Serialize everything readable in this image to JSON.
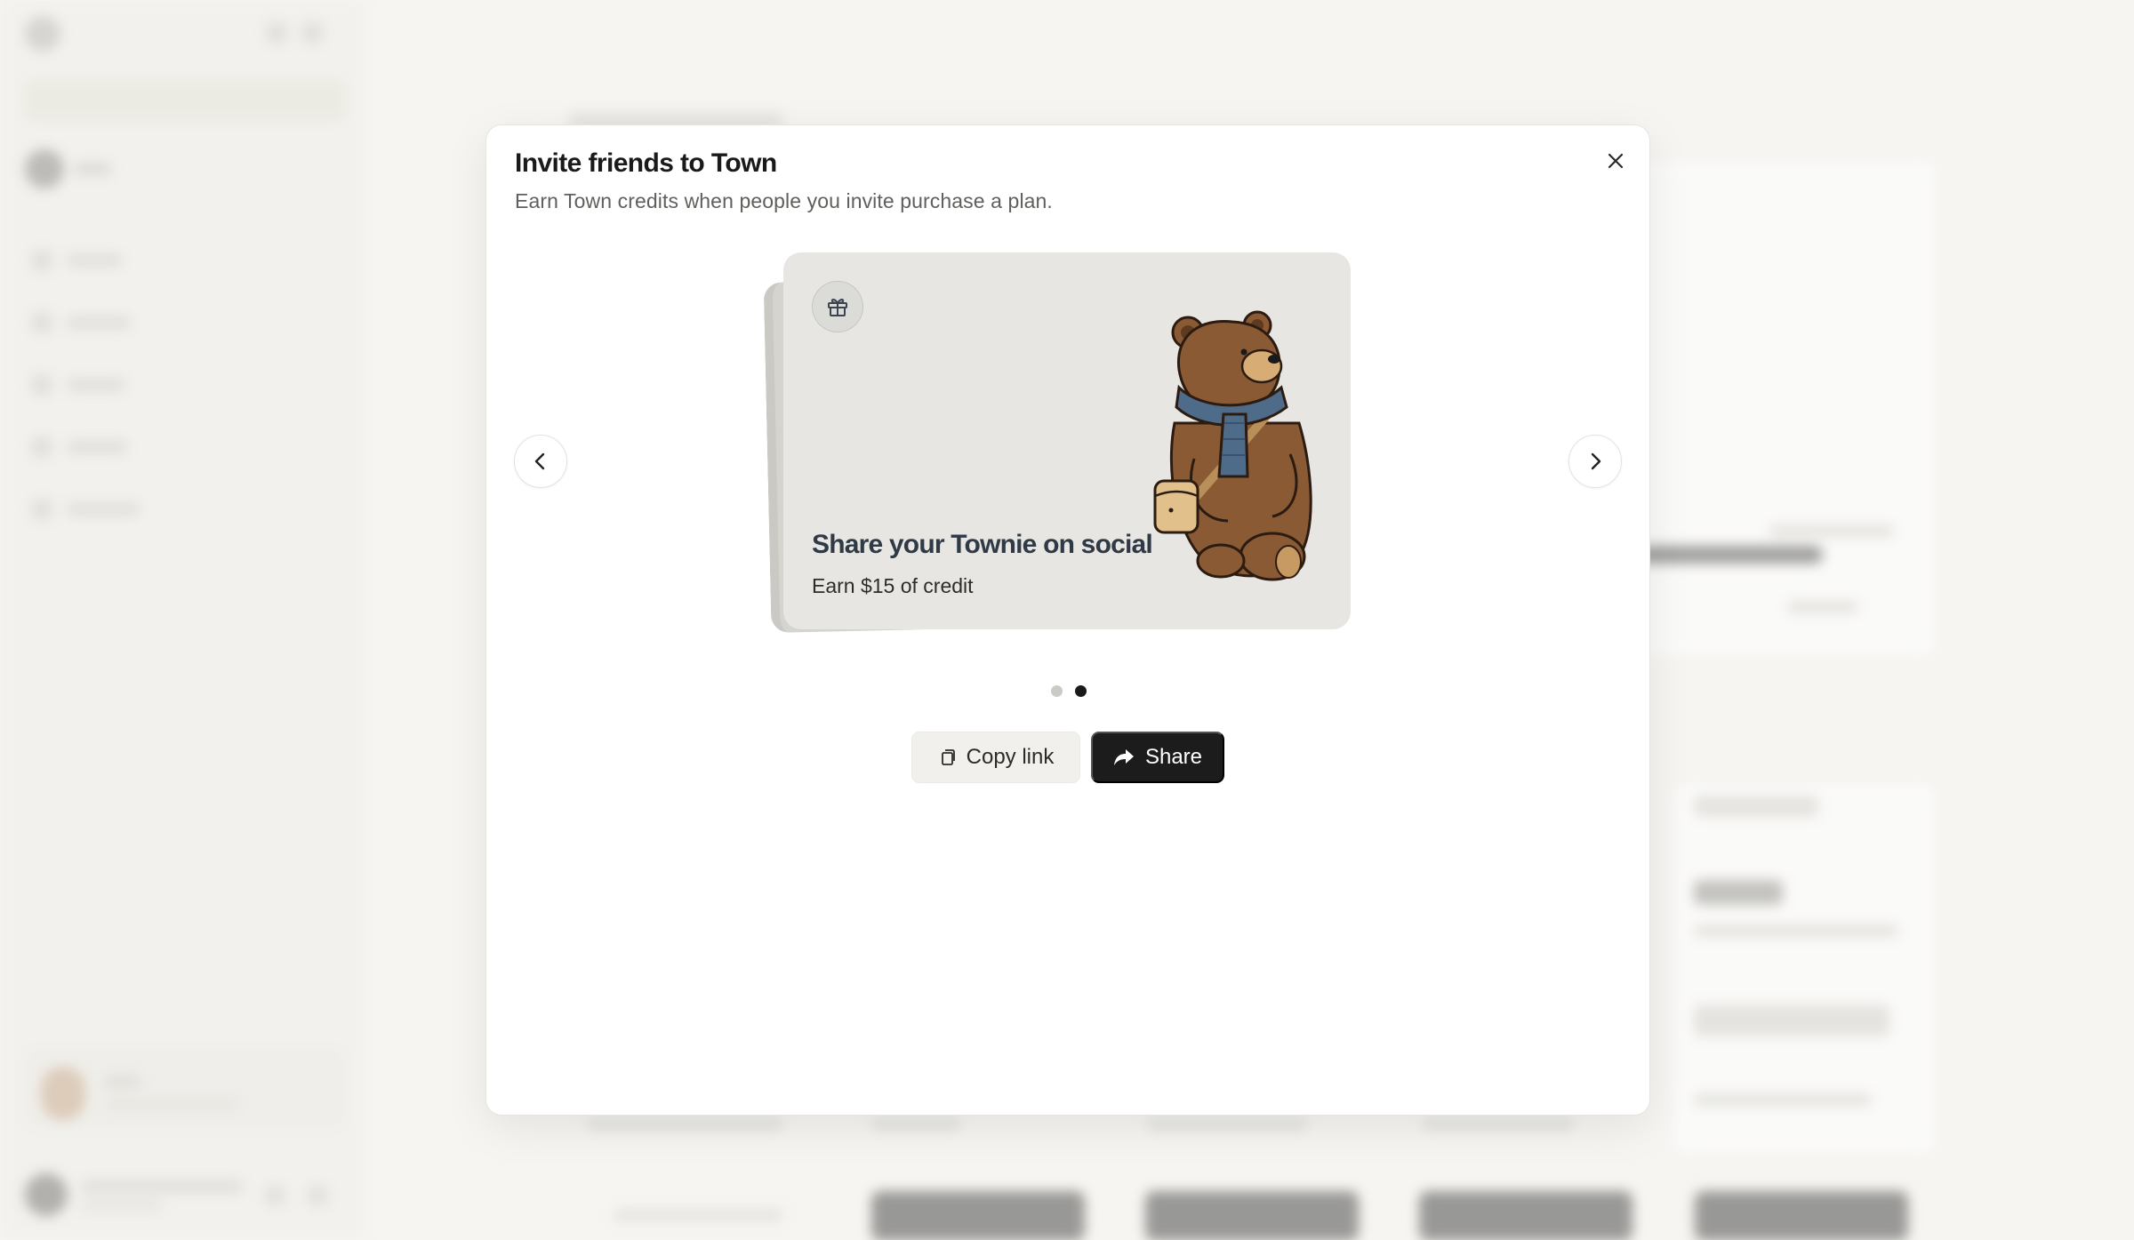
{
  "modal": {
    "title": "Invite friends to Town",
    "subtitle": "Earn Town credits when people you invite purchase a plan."
  },
  "carousel": {
    "active_index": 1,
    "total_slides": 2,
    "slide": {
      "icon": "gift-icon",
      "headline": "Share your Townie on social",
      "subtext": "Earn $15 of credit",
      "illustration": "bear-with-scarf-and-satchel"
    }
  },
  "actions": {
    "copy_label": "Copy link",
    "copy_icon": "copy-icon",
    "share_label": "Share",
    "share_icon": "share-arrow-icon"
  },
  "icons": {
    "close": "close-icon",
    "prev": "chevron-left-icon",
    "next": "chevron-right-icon"
  },
  "colors": {
    "modal_bg": "#ffffff",
    "card_bg": "#e7e6e2",
    "headline": "#2f3a46",
    "share_button_bg": "#1c1c1c",
    "copy_button_bg": "#f1f0ed",
    "dot_active": "#1a1a1a",
    "dot_inactive": "#cbcac6",
    "bear_fur": "#8a5a34",
    "scarf": "#4f6b8a"
  }
}
